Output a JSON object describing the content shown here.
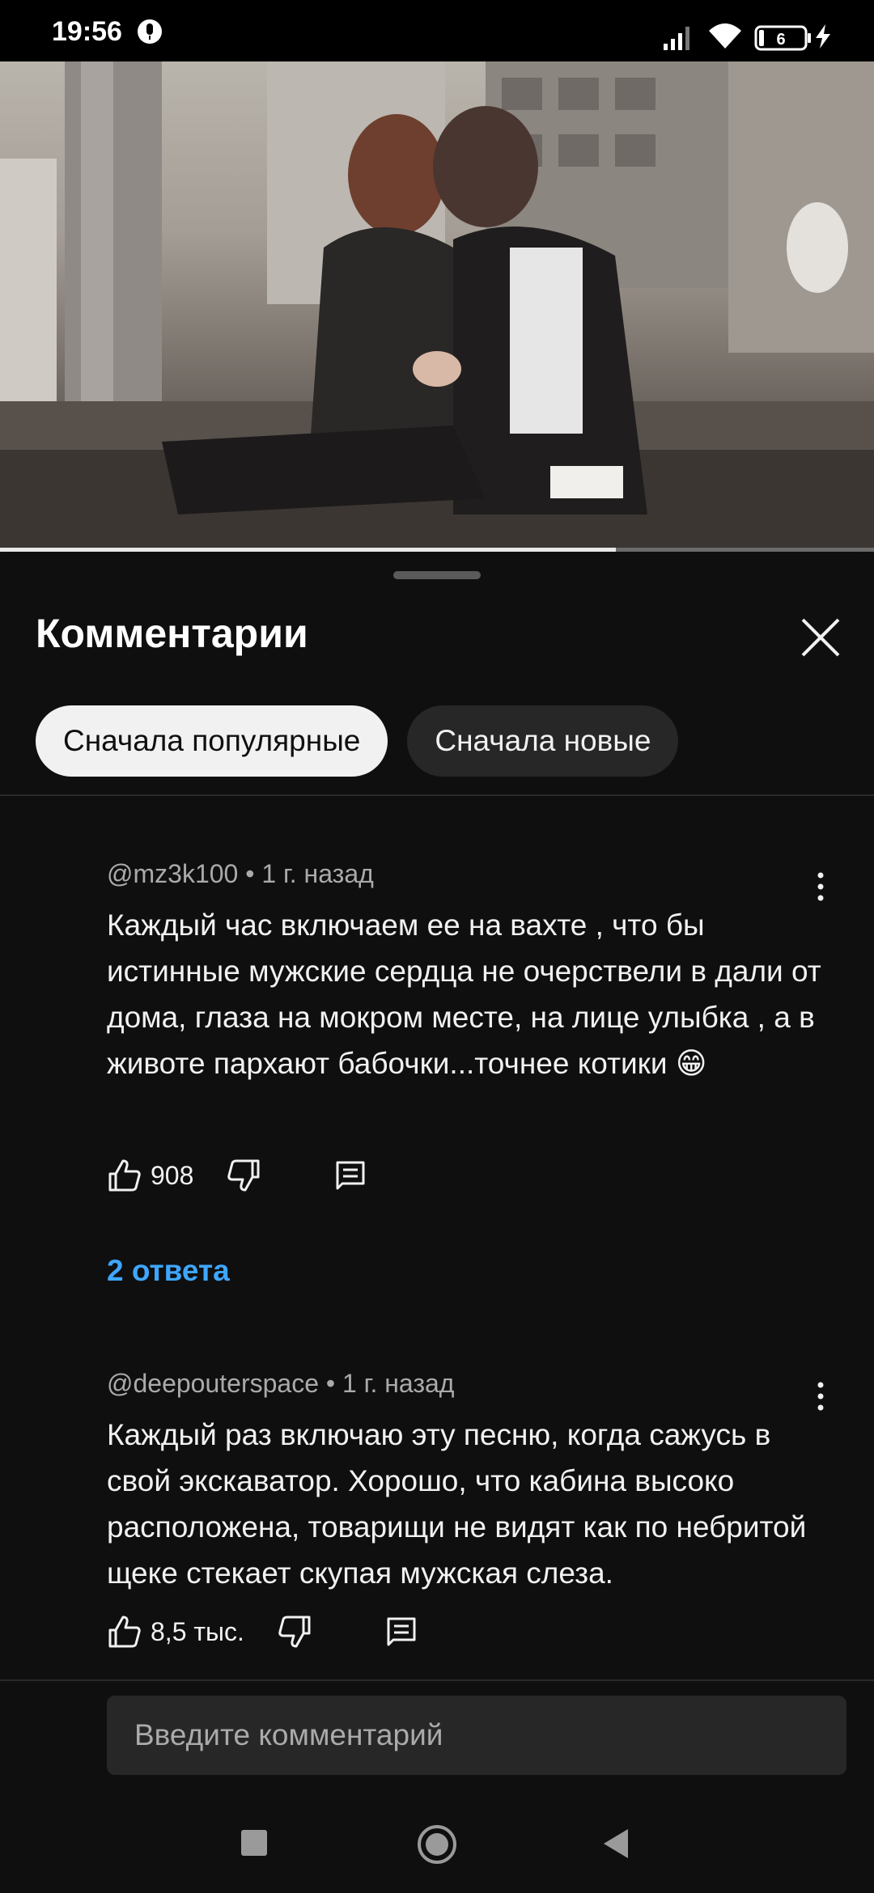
{
  "status_bar": {
    "time": "19:56",
    "battery": "6"
  },
  "video": {
    "progress": 0.705
  },
  "comments_panel": {
    "title": "Комментарии",
    "sort_chips": [
      {
        "label": "Сначала популярные",
        "selected": true
      },
      {
        "label": "Сначала новые",
        "selected": false
      }
    ],
    "comments": [
      {
        "author": "@mz3k100",
        "time": "1 г. назад",
        "text": "Каждый час включаем ее на вахте , что бы истинные мужские сердца не очерствели в дали от дома, глаза на мокром месте, на лице улыбка , а в животе пархают бабочки...точнее котики 😁",
        "likes": "908",
        "replies": "2 ответа"
      },
      {
        "author": "@deepouterspace",
        "time": "1 г. назад",
        "text": "Каждый раз включаю эту песню, когда сажусь в свой экскаватор. Хорошо, что кабина высоко расположена, товарищи не видят как по небритой щеке стекает скупая мужская слеза.",
        "likes": "8,5 тыс."
      }
    ],
    "input_placeholder": "Введите комментарий"
  },
  "colors": {
    "background": "#0f0f0f",
    "chip_active": "#f1f1f1",
    "chip_inactive": "#272727",
    "link": "#3ea6ff",
    "secondary_text": "#aaaaaa"
  },
  "icons": [
    "microphone-icon",
    "signal-icon",
    "wifi-icon",
    "battery-icon",
    "charging-icon",
    "close-icon",
    "more-vert-icon",
    "thumb-up-icon",
    "thumb-down-icon",
    "reply-icon",
    "nav-recents-icon",
    "nav-home-icon",
    "nav-back-icon"
  ]
}
